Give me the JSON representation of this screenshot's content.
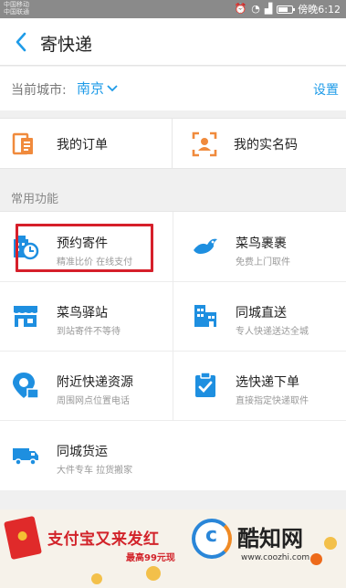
{
  "statusbar": {
    "carrier_line1": "中国移动",
    "carrier_line2": "中国联通",
    "battery_level": 0.7,
    "time": "傍晚6:12"
  },
  "header": {
    "title": "寄快递",
    "back_icon": "chevron-left"
  },
  "city": {
    "label": "当前城市:",
    "value": "南京",
    "settings": "设置"
  },
  "orders": [
    {
      "label": "我的订单",
      "icon": "order-doc",
      "color": "#f08a3c"
    },
    {
      "label": "我的实名码",
      "icon": "qr-face",
      "color": "#f08a3c"
    }
  ],
  "section": {
    "title": "常用功能"
  },
  "features": [
    {
      "title": "预约寄件",
      "subtitle": "精准比价 在线支付",
      "icon": "building-clock",
      "highlighted": true
    },
    {
      "title": "菜鸟裹裹",
      "subtitle": "免费上门取件",
      "icon": "cainiao-bird"
    },
    {
      "title": "菜鸟驿站",
      "subtitle": "到站寄件不等待",
      "icon": "station-shop"
    },
    {
      "title": "同城直送",
      "subtitle": "专人快递送达全城",
      "icon": "city-buildings"
    },
    {
      "title": "附近快递资源",
      "subtitle": "周围网点位置电话",
      "icon": "map-pin"
    },
    {
      "title": "选快递下单",
      "subtitle": "直接指定快递取件",
      "icon": "clipboard-check"
    },
    {
      "title": "同城货运",
      "subtitle": "大件专车 拉货搬家",
      "icon": "truck"
    }
  ],
  "banner": {
    "title": "支付宝又来发红",
    "subtitle": "最高99元现",
    "watermark_name": "酷知网",
    "watermark_url": "www.coozhi.com"
  },
  "colors": {
    "accent": "#1e9be8",
    "icon_blue": "#1e8fe0",
    "icon_orange": "#f08a3c",
    "highlight": "#d61f2a"
  }
}
